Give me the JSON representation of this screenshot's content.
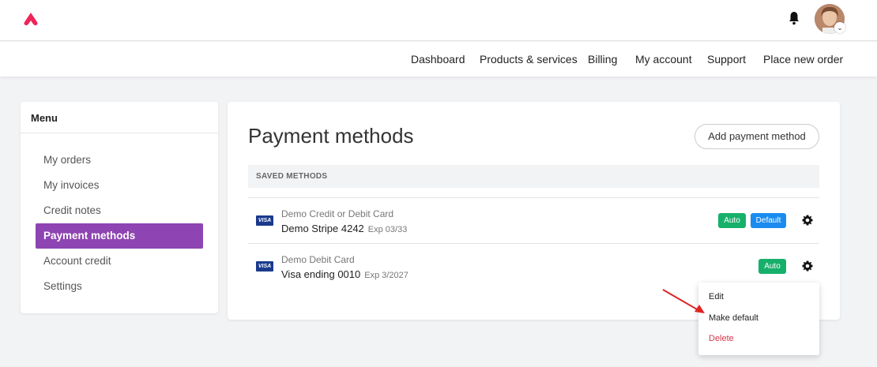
{
  "header": {
    "logo_icon": "brand-logo-icon",
    "notification_icon": "bell-icon",
    "avatar_icon": "user-avatar",
    "brand_color": "#f0245a"
  },
  "nav": {
    "items": [
      "Dashboard",
      "Products & services",
      "Billing",
      "My account",
      "Support",
      "Place new order"
    ]
  },
  "sidebar": {
    "title": "Menu",
    "items": [
      {
        "label": "My orders"
      },
      {
        "label": "My invoices"
      },
      {
        "label": "Credit notes"
      },
      {
        "label": "Payment methods",
        "active": true
      },
      {
        "label": "Account credit"
      },
      {
        "label": "Settings"
      }
    ],
    "active_color": "#8e44b2"
  },
  "main": {
    "title": "Payment methods",
    "add_button": "Add payment method",
    "section_label": "SAVED METHODS",
    "methods": [
      {
        "card_brand": "VISA",
        "name": "Demo Credit or Debit Card",
        "detail": "Demo Stripe 4242",
        "expiry": "Exp 03/33",
        "badges": [
          "Auto",
          "Default"
        ]
      },
      {
        "card_brand": "VISA",
        "name": "Demo Debit Card",
        "detail": "Visa ending 0010",
        "expiry": "Exp 3/2027",
        "badges": [
          "Auto"
        ]
      }
    ],
    "badge_colors": {
      "auto": "#17b06b",
      "default": "#1a8cf0"
    }
  },
  "dropdown": {
    "items": [
      "Edit",
      "Make default",
      "Delete"
    ],
    "danger_color": "#d6364b"
  }
}
